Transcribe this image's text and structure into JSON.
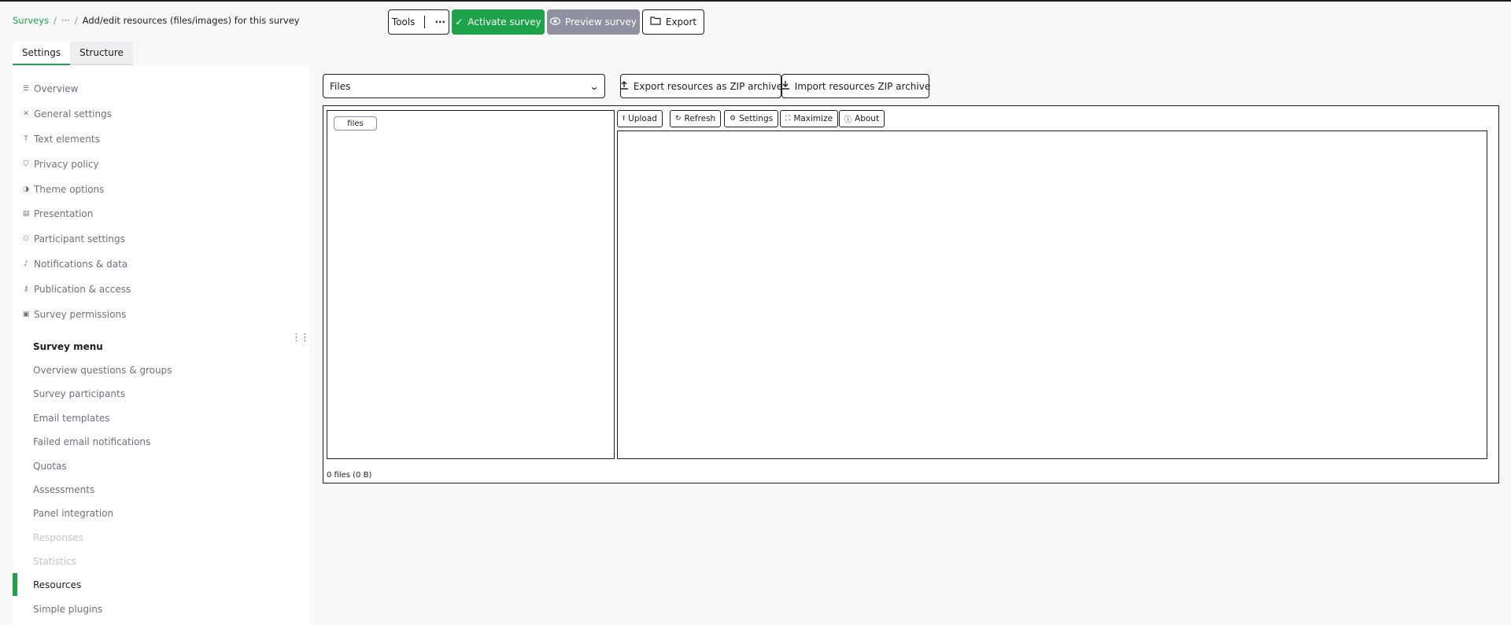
{
  "breadcrumb": {
    "root": "Surveys",
    "ellipsis": "···",
    "current": "Add/edit resources (files/images) for this survey",
    "separator": "/"
  },
  "toolbar": {
    "tools_label": "Tools",
    "more_glyph": "···",
    "activate_label": "Activate survey",
    "preview_label": "Preview survey",
    "export_label": "Export"
  },
  "tabs": [
    {
      "label": "Settings",
      "active": true
    },
    {
      "label": "Structure",
      "active": false
    }
  ],
  "sidebar": {
    "settings_items": [
      {
        "label": "Overview",
        "icon": "overview-icon"
      },
      {
        "label": "General settings",
        "icon": "tools-icon"
      },
      {
        "label": "Text elements",
        "icon": "text-icon"
      },
      {
        "label": "Privacy policy",
        "icon": "shield-icon"
      },
      {
        "label": "Theme options",
        "icon": "contrast-icon"
      },
      {
        "label": "Presentation",
        "icon": "presentation-icon"
      },
      {
        "label": "Participant settings",
        "icon": "participant-icon"
      },
      {
        "label": "Notifications & data",
        "icon": "bell-icon"
      },
      {
        "label": "Publication & access",
        "icon": "key-icon"
      },
      {
        "label": "Survey permissions",
        "icon": "lock-icon"
      }
    ],
    "menu_heading": "Survey menu",
    "menu_items": [
      {
        "label": "Overview questions & groups",
        "state": "normal"
      },
      {
        "label": "Survey participants",
        "state": "normal"
      },
      {
        "label": "Email templates",
        "state": "normal"
      },
      {
        "label": "Failed email notifications",
        "state": "normal"
      },
      {
        "label": "Quotas",
        "state": "normal"
      },
      {
        "label": "Assessments",
        "state": "normal"
      },
      {
        "label": "Panel integration",
        "state": "normal"
      },
      {
        "label": "Responses",
        "state": "disabled"
      },
      {
        "label": "Statistics",
        "state": "disabled"
      },
      {
        "label": "Resources",
        "state": "active"
      },
      {
        "label": "Simple plugins",
        "state": "normal"
      }
    ]
  },
  "main": {
    "select_value": "Files",
    "export_zip_label": "Export resources as ZIP archive",
    "import_zip_label": "Import resources ZIP archive",
    "file_manager": {
      "tree_root": "files",
      "toolbar": [
        {
          "label": "Upload",
          "icon": "upload-icon"
        },
        {
          "label": "Refresh",
          "icon": "refresh-icon"
        },
        {
          "label": "Settings",
          "icon": "gear-icon"
        },
        {
          "label": "Maximize",
          "icon": "maximize-icon"
        },
        {
          "label": "About",
          "icon": "info-icon"
        }
      ],
      "status": "0 files (0 B)"
    }
  },
  "colors": {
    "accent": "#1ea24a",
    "preview_button": "#8f91a0",
    "background": "#f8f8f9"
  }
}
